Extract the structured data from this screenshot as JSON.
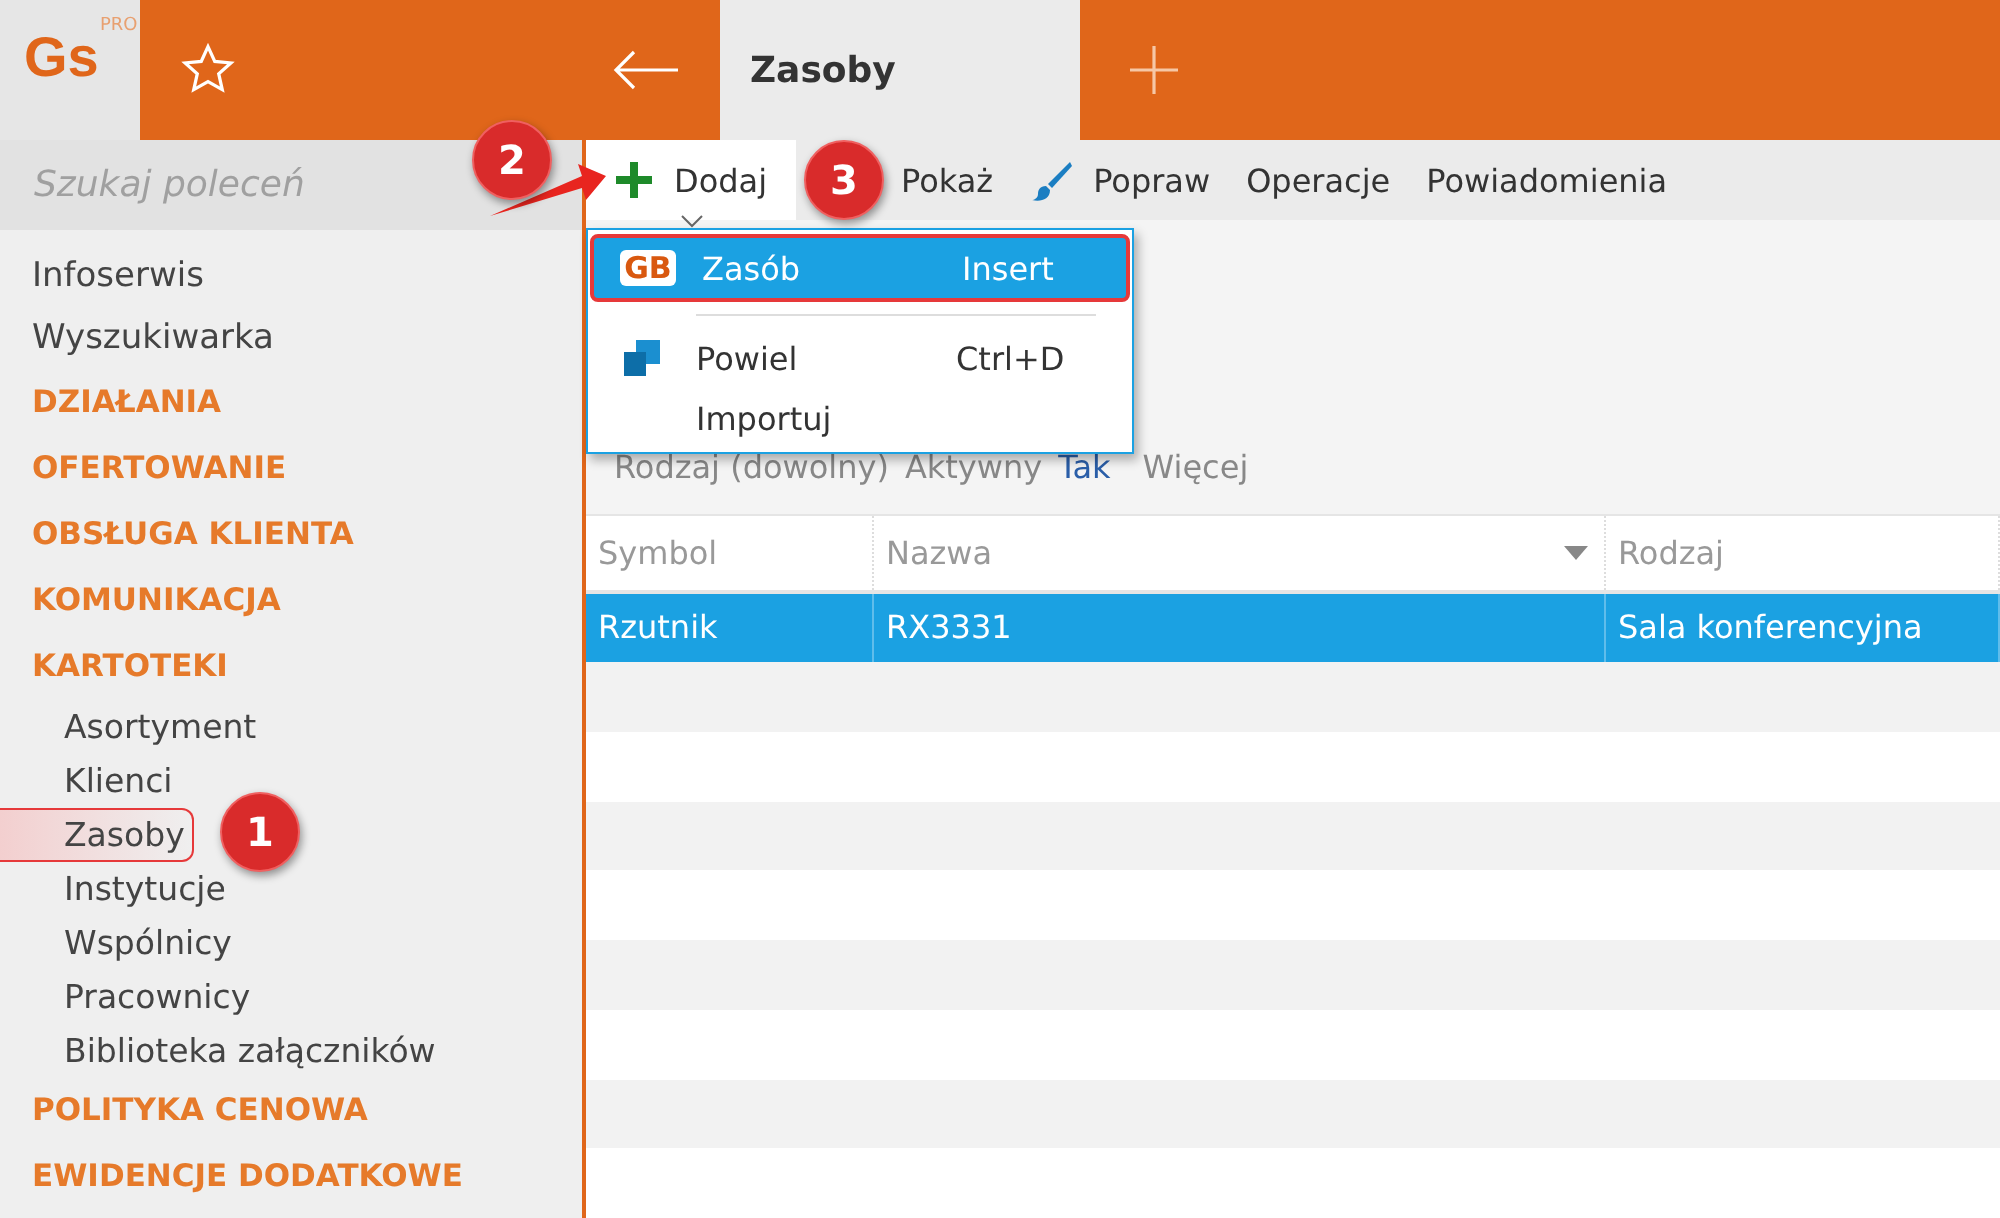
{
  "app": {
    "logo": "Gs",
    "logo_badge": "PRO"
  },
  "tabs": [
    {
      "label": "Zasoby",
      "selected": true
    }
  ],
  "search": {
    "placeholder": "Szukaj poleceń"
  },
  "sidebar": {
    "items": [
      {
        "kind": "link",
        "label": "Infoserwis",
        "selected": false
      },
      {
        "kind": "link",
        "label": "Wyszukiwarka",
        "selected": false
      },
      {
        "kind": "section",
        "label": "DZIAŁANIA",
        "selected": false
      },
      {
        "kind": "section",
        "label": "OFERTOWANIE",
        "selected": false
      },
      {
        "kind": "section",
        "label": "OBSŁUGA KLIENTA",
        "selected": false
      },
      {
        "kind": "section",
        "label": "KOMUNIKACJA",
        "selected": false
      },
      {
        "kind": "section",
        "label": "KARTOTEKI",
        "selected": false,
        "children": [
          {
            "label": "Asortyment",
            "selected": false
          },
          {
            "label": "Klienci",
            "selected": false
          },
          {
            "label": "Zasoby",
            "selected": true
          },
          {
            "label": "Instytucje",
            "selected": false
          },
          {
            "label": "Wspólnicy",
            "selected": false
          },
          {
            "label": "Pracownicy",
            "selected": false
          },
          {
            "label": "Biblioteka załączników",
            "selected": false
          }
        ]
      },
      {
        "kind": "section",
        "label": "POLITYKA CENOWA",
        "selected": false
      },
      {
        "kind": "section",
        "label": "EWIDENCJE DODATKOWE",
        "selected": false
      }
    ]
  },
  "toolbar": [
    {
      "kind": "add",
      "label": "Dodaj",
      "selected": true
    },
    {
      "kind": "show",
      "label": "Pokaż",
      "selected": false
    },
    {
      "kind": "edit",
      "label": "Popraw",
      "selected": false
    },
    {
      "kind": "plain",
      "label": "Operacje",
      "selected": false
    },
    {
      "kind": "plain",
      "label": "Powiadomienia",
      "selected": false
    }
  ],
  "menu": [
    {
      "kind": "resource",
      "icon_text": "GB",
      "label": "Zasób",
      "shortcut": "Insert",
      "selected": true
    },
    {
      "kind": "copy",
      "label": "Powiel",
      "shortcut": "Ctrl+D",
      "selected": false
    },
    {
      "kind": "plain",
      "label": "Importuj",
      "selected": false
    }
  ],
  "filters": [
    {
      "label": "Rodzaj (dowolny)"
    },
    {
      "label": "Aktywny",
      "value": "Tak"
    },
    {
      "label": "Więcej"
    }
  ],
  "table": {
    "columns": [
      "Symbol",
      "Nazwa",
      "Rodzaj"
    ],
    "rows": [
      {
        "cells": [
          "Rzutnik",
          "RX3331",
          "Sala konferencyjna"
        ],
        "selected": true
      }
    ]
  },
  "callouts": [
    "1",
    "2",
    "3"
  ]
}
